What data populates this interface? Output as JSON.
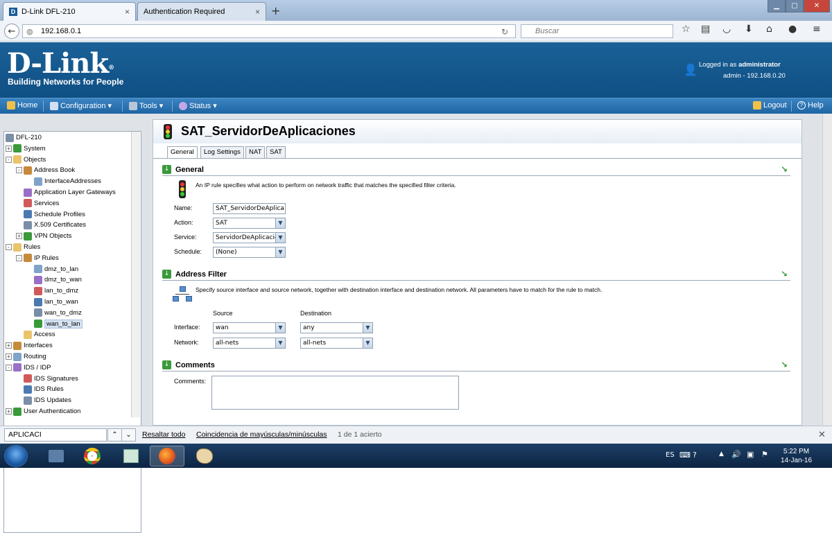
{
  "browser": {
    "tabs": [
      {
        "label": "D-Link DFL-210",
        "active": true
      },
      {
        "label": "Authentication Required",
        "active": false
      }
    ],
    "new_tab_label": "+",
    "url": "192.168.0.1",
    "search_placeholder": "Buscar",
    "window_buttons": [
      "minimize",
      "maximize",
      "close"
    ]
  },
  "header": {
    "logo": "D-Link",
    "tagline": "Building Networks for People",
    "logged_in_prefix": "Logged in as",
    "logged_in_user": "administrator",
    "session": "admin - 192.168.0.20"
  },
  "menubar": {
    "home": "Home",
    "configuration": "Configuration",
    "tools": "Tools",
    "status": "Status",
    "logout": "Logout",
    "help": "Help"
  },
  "tree": {
    "items": [
      {
        "label": "DFL-210",
        "level": 0
      },
      {
        "label": "System",
        "level": 0,
        "toggle": "+"
      },
      {
        "label": "Objects",
        "level": 0,
        "toggle": "-"
      },
      {
        "label": "Address Book",
        "level": 1,
        "toggle": "-"
      },
      {
        "label": "InterfaceAddresses",
        "level": 2
      },
      {
        "label": "Application Layer Gateways",
        "level": 1
      },
      {
        "label": "Services",
        "level": 1
      },
      {
        "label": "Schedule Profiles",
        "level": 1
      },
      {
        "label": "X.509 Certificates",
        "level": 1
      },
      {
        "label": "VPN Objects",
        "level": 1,
        "toggle": "+"
      },
      {
        "label": "Rules",
        "level": 0,
        "toggle": "-"
      },
      {
        "label": "IP Rules",
        "level": 1,
        "toggle": "-"
      },
      {
        "label": "dmz_to_lan",
        "level": 2
      },
      {
        "label": "dmz_to_wan",
        "level": 2
      },
      {
        "label": "lan_to_dmz",
        "level": 2
      },
      {
        "label": "lan_to_wan",
        "level": 2
      },
      {
        "label": "wan_to_dmz",
        "level": 2
      },
      {
        "label": "wan_to_lan",
        "level": 2,
        "selected": true
      },
      {
        "label": "Access",
        "level": 1
      },
      {
        "label": "Interfaces",
        "level": 0,
        "toggle": "+"
      },
      {
        "label": "Routing",
        "level": 0,
        "toggle": "+"
      },
      {
        "label": "IDS / IDP",
        "level": 0,
        "toggle": "-"
      },
      {
        "label": "IDS Signatures",
        "level": 1
      },
      {
        "label": "IDS Rules",
        "level": 1
      },
      {
        "label": "IDS Updates",
        "level": 1
      },
      {
        "label": "User Authentication",
        "level": 0,
        "toggle": "+"
      }
    ]
  },
  "main": {
    "title": "SAT_ServidorDeAplicaciones",
    "tabs": [
      "General",
      "Log Settings",
      "NAT",
      "SAT"
    ],
    "general": {
      "heading": "General",
      "description": "An IP rule specifies what action to perform on network traffic that matches the specified filter criteria.",
      "name_label": "Name:",
      "name_value": "SAT_ServidorDeAplica",
      "action_label": "Action:",
      "action_value": "SAT",
      "service_label": "Service:",
      "service_value": "ServidorDeAplicacio",
      "schedule_label": "Schedule:",
      "schedule_value": "(None)"
    },
    "address_filter": {
      "heading": "Address Filter",
      "description": "Specify source interface and source network, together with destination interface and destination network. All parameters have to match for the rule to match.",
      "source_header": "Source",
      "destination_header": "Destination",
      "interface_label": "Interface:",
      "network_label": "Network:",
      "src_interface": "wan",
      "dst_interface": "any",
      "src_network": "all-nets",
      "dst_network": "all-nets"
    },
    "comments": {
      "heading": "Comments",
      "label": "Comments:",
      "value": ""
    }
  },
  "findbar": {
    "query": "APLICACI",
    "highlight_all": "Resaltar todo",
    "match_case": "Coincidencia de mayúsculas/minúsculas",
    "result": "1 de 1 acierto"
  },
  "taskbar": {
    "lang": "ES",
    "time": "5:22 PM",
    "date": "14-Jan-16"
  }
}
